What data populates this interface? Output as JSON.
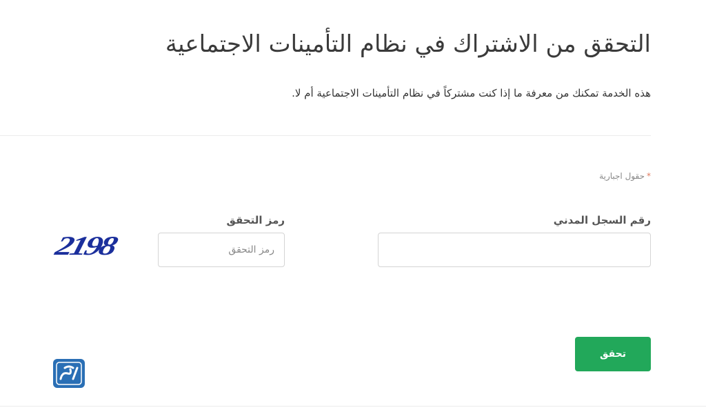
{
  "header": {
    "title": "التحقق من الاشتراك في نظام التأمينات الاجتماعية",
    "description": "هذه الخدمة تمكنك من معرفة ما إذا كنت مشتركاً في نظام التأمينات الاجتماعية أم لا."
  },
  "form": {
    "required_note": "حقول اجبارية",
    "required_marker": "*",
    "civil_id": {
      "label": "رقم السجل المدني",
      "value": "",
      "placeholder": ""
    },
    "captcha": {
      "label": "رمز التحقق",
      "placeholder": "رمز التحقق",
      "image_text": "2198"
    },
    "submit_label": "تحقق"
  },
  "colors": {
    "accent": "#22a85a",
    "captcha_text": "#1b2f9c",
    "logo_bg": "#2a6fb5"
  },
  "icons": {
    "logo": "almrj3-logo-icon"
  }
}
